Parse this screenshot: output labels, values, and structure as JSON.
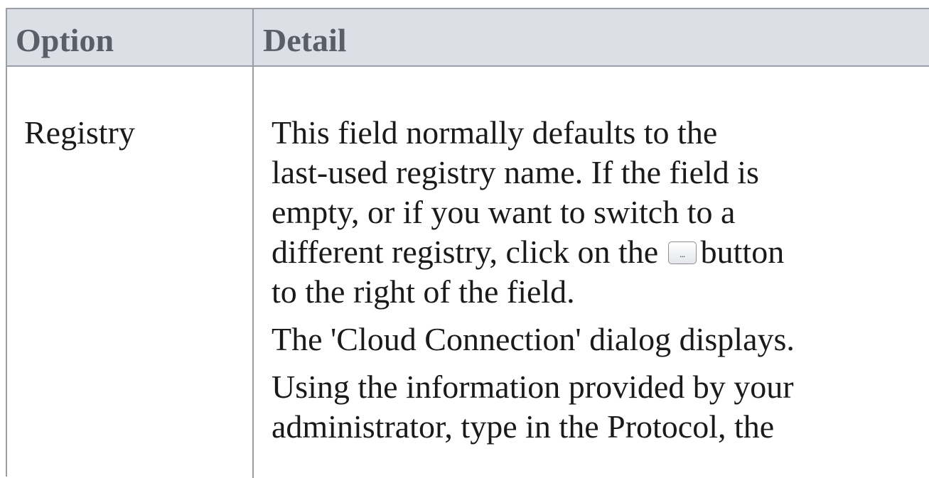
{
  "table": {
    "headers": {
      "option": "Option",
      "detail": "Detail"
    },
    "rows": [
      {
        "option": "Registry",
        "detail": {
          "line1": "This field normally defaults to the",
          "line2": "last-used registry name. If the field is",
          "line3": "empty, or if you want to switch to a",
          "line4_before": "different registry, click on the",
          "button_glyph": "...",
          "line4_after": "button",
          "line5": "to the right of the field.",
          "para2": "The 'Cloud Connection' dialog displays.",
          "para3_line1": "Using the information provided by your",
          "para3_line2": "administrator, type in the Protocol, the"
        }
      }
    ]
  }
}
